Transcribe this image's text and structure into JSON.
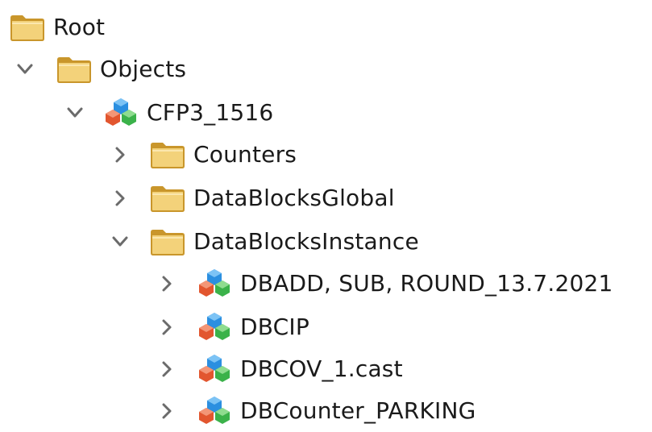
{
  "tree": {
    "root": {
      "label": "Root",
      "icon": "folder-icon"
    },
    "objects": {
      "label": "Objects",
      "icon": "folder-icon",
      "expanded": true
    },
    "cfp3": {
      "label": "CFP3_1516",
      "icon": "component-cubes-icon",
      "expanded": true
    },
    "counters": {
      "label": "Counters",
      "icon": "folder-icon",
      "expanded": false
    },
    "datablocks_global": {
      "label": "DataBlocksGlobal",
      "icon": "folder-icon",
      "expanded": false
    },
    "datablocks_instance": {
      "label": "DataBlocksInstance",
      "icon": "folder-icon",
      "expanded": true
    },
    "instances": [
      {
        "label": "DBADD, SUB, ROUND_13.7.2021",
        "icon": "component-cubes-icon",
        "expanded": false
      },
      {
        "label": "DBCIP",
        "icon": "component-cubes-icon",
        "expanded": false
      },
      {
        "label": "DBCOV_1.cast",
        "icon": "component-cubes-icon",
        "expanded": false
      },
      {
        "label": "DBCounter_PARKING",
        "icon": "component-cubes-icon",
        "expanded": false
      }
    ]
  },
  "colors": {
    "folder_fill": "#f3d27a",
    "folder_dark": "#c9962b",
    "cube_blue": "#2b8fe0",
    "cube_red": "#e2562f",
    "cube_green": "#3bb24a",
    "chevron": "#6b6b6b"
  }
}
